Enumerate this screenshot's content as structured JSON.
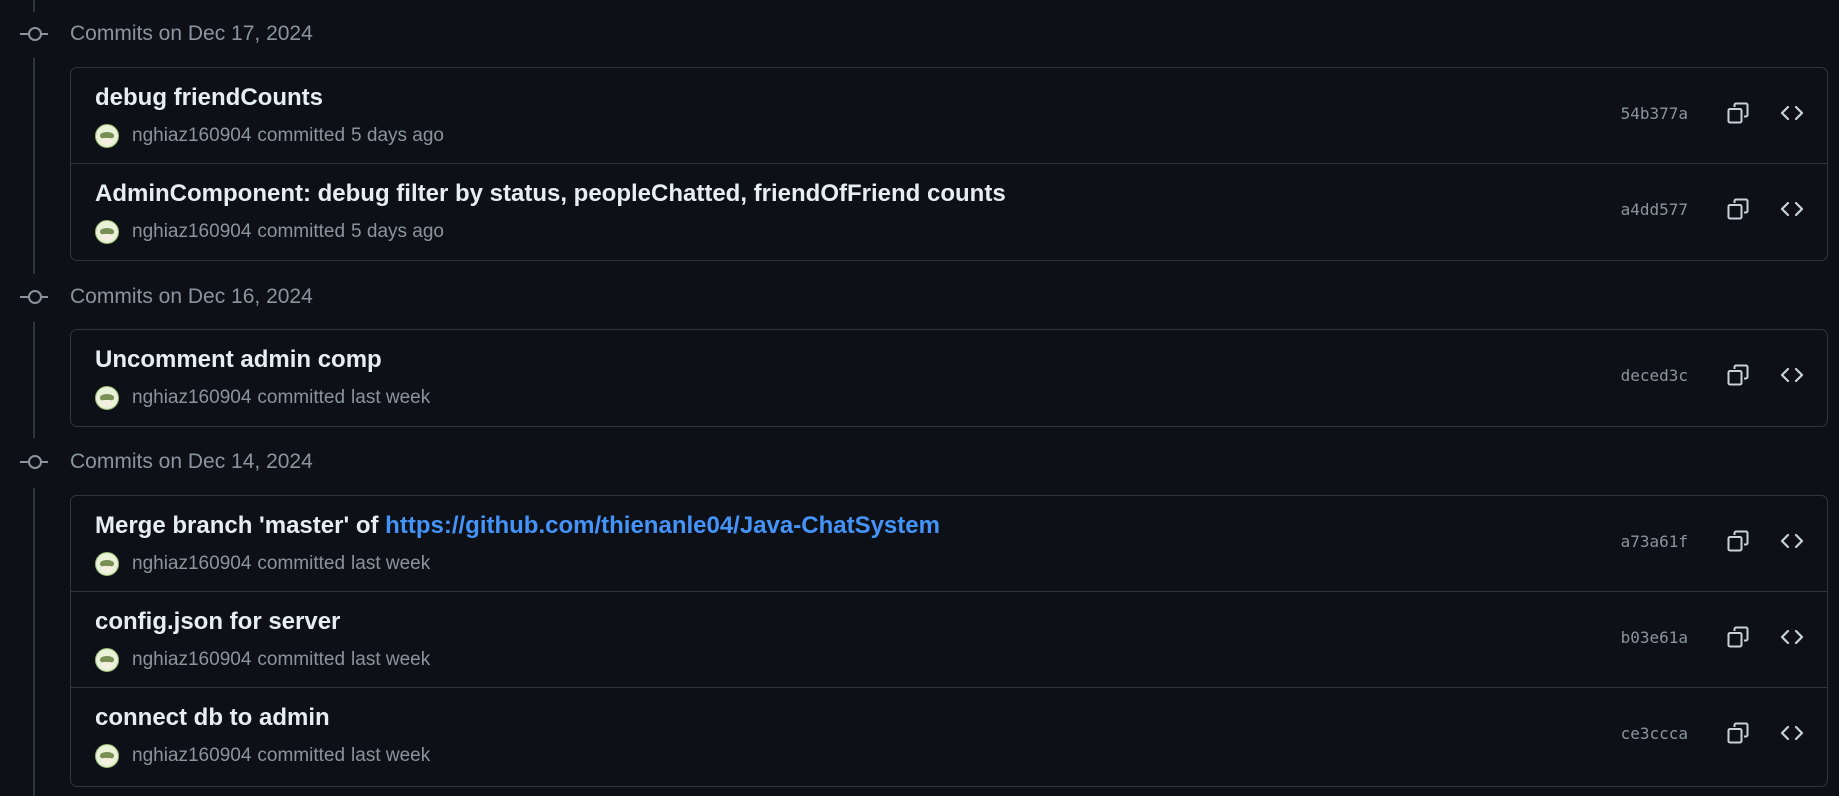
{
  "groups": [
    {
      "title": "Commits on Dec 17, 2024",
      "commits": [
        {
          "message": "debug friendCounts",
          "author": "nghiaz160904",
          "action": "committed",
          "time": "5 days ago",
          "sha": "54b377a"
        },
        {
          "message": "AdminComponent: debug filter by status, peopleChatted, friendOfFriend counts",
          "author": "nghiaz160904",
          "action": "committed",
          "time": "5 days ago",
          "sha": "a4dd577"
        }
      ]
    },
    {
      "title": "Commits on Dec 16, 2024",
      "commits": [
        {
          "message": "Uncomment admin comp",
          "author": "nghiaz160904",
          "action": "committed",
          "time": "last week",
          "sha": "deced3c"
        }
      ]
    },
    {
      "title": "Commits on Dec 14, 2024",
      "commits": [
        {
          "message": "Merge branch 'master' of",
          "link": "https://github.com/thienanle04/Java-ChatSystem",
          "author": "nghiaz160904",
          "action": "committed",
          "time": "last week",
          "sha": "a73a61f"
        },
        {
          "message": "config.json for server",
          "author": "nghiaz160904",
          "action": "committed",
          "time": "last week",
          "sha": "b03e61a"
        },
        {
          "message": "connect db to admin",
          "author": "nghiaz160904",
          "action": "committed",
          "time": "last week",
          "sha": "ce3ccca"
        }
      ]
    }
  ],
  "icons": {
    "group": "git-commit-icon",
    "copy": "copy-icon",
    "browse": "code-icon",
    "avatar": "avatar"
  },
  "colors": {
    "background": "#0d1117",
    "border": "#30363d",
    "muted": "#8b949e",
    "text": "#e6edf3",
    "link": "#4493f8"
  }
}
